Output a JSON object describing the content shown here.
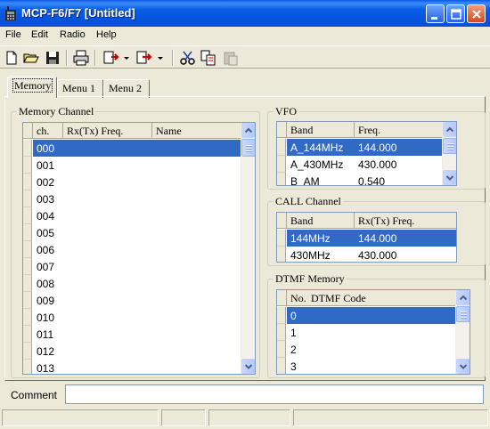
{
  "window": {
    "title": "MCP-F6/F7 [Untitled]"
  },
  "menu": [
    "File",
    "Edit",
    "Radio",
    "Help"
  ],
  "toolbar": {
    "icons": [
      "new-icon",
      "open-icon",
      "save-icon",
      "print-icon",
      "read-from-radio-icon",
      "dropdown-icon",
      "write-to-radio-icon",
      "dropdown-icon",
      "cut-icon",
      "copy-icon",
      "paste-icon"
    ]
  },
  "tabs": [
    {
      "label": "Memory",
      "active": true
    },
    {
      "label": "Menu 1",
      "active": false
    },
    {
      "label": "Menu 2",
      "active": false
    }
  ],
  "memory_channel": {
    "title": "Memory Channel",
    "columns": [
      "ch.",
      "Rx(Tx) Freq.",
      "Name"
    ],
    "rows": [
      "000",
      "001",
      "002",
      "003",
      "004",
      "005",
      "006",
      "007",
      "008",
      "009",
      "010",
      "011",
      "012",
      "013"
    ],
    "selected_index": 0
  },
  "vfo": {
    "title": "VFO",
    "columns": [
      "Band",
      "Freq."
    ],
    "rows": [
      {
        "band": "A_144MHz",
        "freq": "144.000"
      },
      {
        "band": "A_430MHz",
        "freq": "430.000"
      },
      {
        "band": "B_AM",
        "freq": "0.540"
      }
    ],
    "selected_index": 0
  },
  "call_channel": {
    "title": "CALL Channel",
    "columns": [
      "Band",
      "Rx(Tx) Freq."
    ],
    "rows": [
      {
        "band": "144MHz",
        "freq": "144.000"
      },
      {
        "band": "430MHz",
        "freq": "430.000"
      }
    ],
    "selected_index": 0
  },
  "dtmf_memory": {
    "title": "DTMF Memory",
    "columns": [
      "No.",
      "DTMF Code"
    ],
    "rows": [
      "0",
      "1",
      "2",
      "3"
    ],
    "selected_index": 0
  },
  "comment": {
    "label": "Comment",
    "value": ""
  },
  "colors": {
    "selection": "#316ac5",
    "titlebar": "#0a5ee8",
    "face": "#ece9d8"
  }
}
